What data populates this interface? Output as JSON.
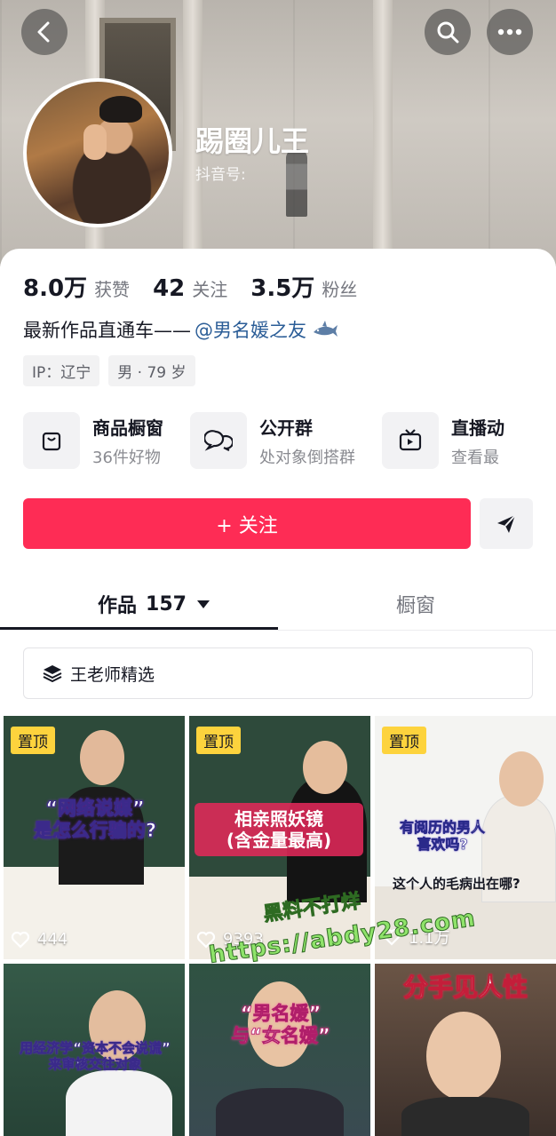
{
  "profile": {
    "nickname": "踢圈儿王",
    "douyin_id_label": "抖音号:"
  },
  "stats": [
    {
      "value": "8.0万",
      "label": "获赞"
    },
    {
      "value": "42",
      "label": "关注"
    },
    {
      "value": "3.5万",
      "label": "粉丝"
    }
  ],
  "bio": {
    "text": "最新作品直通车——",
    "mention": "@男名媛之友"
  },
  "tags": [
    "IP：辽宁",
    "男 · 79 岁"
  ],
  "shortcuts": [
    {
      "title": "商品橱窗",
      "subtitle": "36件好物",
      "icon": "bag-icon"
    },
    {
      "title": "公开群",
      "subtitle": "处对象倒搭群",
      "icon": "chat-bubbles-icon"
    },
    {
      "title": "直播动",
      "subtitle": "查看最",
      "icon": "tv-icon"
    }
  ],
  "actions": {
    "follow_label": "+ 关注"
  },
  "tabs": {
    "works_label": "作品",
    "works_count": "157",
    "shop_label": "橱窗"
  },
  "collection": {
    "label": "王老师精选"
  },
  "videos": [
    {
      "pinned": "置顶",
      "likes": "444",
      "headline": [
        "“网络说媒”",
        "是怎么行骗的?"
      ]
    },
    {
      "pinned": "置顶",
      "likes": "9393",
      "headline": [
        "相亲照妖镜",
        "(含金量最高)"
      ]
    },
    {
      "pinned": "置顶",
      "likes": "1.1万",
      "headline": [
        "有阅历的男人",
        "喜欢吗?"
      ],
      "subtitle": "这个人的毛病出在哪?"
    },
    {
      "headline": [
        "用经济学“资本不会说谎”",
        "来审核交往对象"
      ]
    },
    {
      "headline": [
        "“男名媛”",
        "与“女名媛”"
      ]
    },
    {
      "headline": [
        "分手见人性"
      ]
    }
  ],
  "watermark": {
    "line1": "黑料不打烊",
    "line2": "https://abdy28.com"
  },
  "colors": {
    "accent": "#fe2c55",
    "mention": "#2b5d97",
    "pin_badge": "#fdd33d"
  }
}
